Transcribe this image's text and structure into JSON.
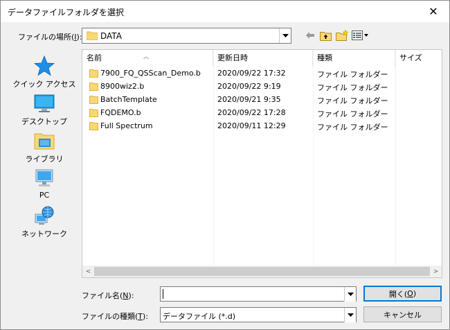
{
  "window": {
    "title": "データファイルフォルダを選択",
    "close_glyph": "✕"
  },
  "lookin": {
    "label_pre": "ファイルの場所(",
    "label_key": "I",
    "label_post": "):",
    "value": "DATA"
  },
  "toolbar": {
    "back_icon": "back-arrow-icon",
    "up_icon": "up-folder-icon",
    "new_icon": "new-folder-icon",
    "view_icon": "view-menu-icon"
  },
  "places": [
    {
      "label": "クイック アクセス",
      "icon": "star-icon"
    },
    {
      "label": "デスクトップ",
      "icon": "desktop-icon"
    },
    {
      "label": "ライブラリ",
      "icon": "library-icon"
    },
    {
      "label": "PC",
      "icon": "pc-icon"
    },
    {
      "label": "ネットワーク",
      "icon": "network-icon"
    }
  ],
  "columns": {
    "name": "名前",
    "date": "更新日時",
    "type": "種類",
    "size": "サイズ"
  },
  "files": [
    {
      "name": "7900_FQ_QSScan_Demo.b",
      "date": "2020/09/22 17:32",
      "type": "ファイル フォルダー"
    },
    {
      "name": "8900wiz2.b",
      "date": "2020/09/22 9:19",
      "type": "ファイル フォルダー"
    },
    {
      "name": "BatchTemplate",
      "date": "2020/09/21 9:35",
      "type": "ファイル フォルダー"
    },
    {
      "name": "FQDEMO.b",
      "date": "2020/09/22 17:28",
      "type": "ファイル フォルダー"
    },
    {
      "name": "Full Spectrum",
      "date": "2020/09/11 12:29",
      "type": "ファイル フォルダー"
    }
  ],
  "filename": {
    "label_pre": "ファイル名(",
    "label_key": "N",
    "label_post": "):",
    "value": ""
  },
  "filetype": {
    "label_pre": "ファイルの種類(",
    "label_key": "T",
    "label_post": "):",
    "value": "データファイル (*.d)"
  },
  "buttons": {
    "open_pre": "開く(",
    "open_key": "O",
    "open_post": ")",
    "cancel": "キャンセル"
  },
  "colors": {
    "folder": "#f8d775",
    "folder_dark": "#e0b440",
    "accent": "#0078d7"
  }
}
